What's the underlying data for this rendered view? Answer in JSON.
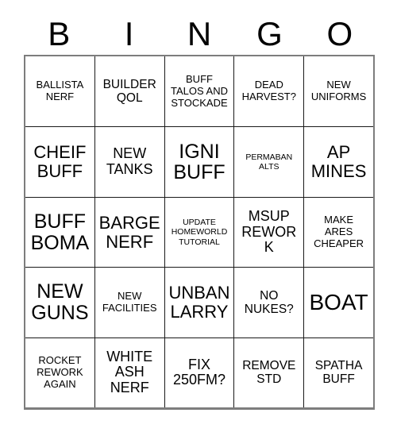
{
  "card": {
    "header_letters": [
      "B",
      "I",
      "N",
      "G",
      "O"
    ],
    "columns": 5,
    "rows": 5,
    "colors": {
      "background": "#ffffff",
      "text": "#000000",
      "inner_grid_line": "#1a1a1a",
      "outer_border": "#7d7d7d"
    },
    "cells": [
      {
        "text": "BALLISTA\nNERF",
        "size": "sm"
      },
      {
        "text": "BUILDER\nQOL",
        "size": "md"
      },
      {
        "text": "BUFF\nTALOS AND\nSTOCKADE",
        "size": "sm"
      },
      {
        "text": "DEAD\nHARVEST?",
        "size": "sm"
      },
      {
        "text": "NEW\nUNIFORMS",
        "size": "sm"
      },
      {
        "text": "CHEIF\nBUFF",
        "size": "xl"
      },
      {
        "text": "NEW\nTANKS",
        "size": "lg"
      },
      {
        "text": "IGNI\nBUFF",
        "size": "xxl"
      },
      {
        "text": "PERMABAN\nALTS",
        "size": "xs"
      },
      {
        "text": "AP\nMINES",
        "size": "xl"
      },
      {
        "text": "BUFF\nBOMA",
        "size": "xxl"
      },
      {
        "text": "BARGE\nNERF",
        "size": "xl"
      },
      {
        "text": "UPDATE\nHOMEWORLD\nTUTORIAL",
        "size": "xs"
      },
      {
        "text": "MSUP\nREWORK",
        "size": "lg"
      },
      {
        "text": "MAKE\nARES\nCHEAPER",
        "size": "sm"
      },
      {
        "text": "NEW\nGUNS",
        "size": "xxl"
      },
      {
        "text": "NEW\nFACILITIES",
        "size": "sm"
      },
      {
        "text": "UNBAN\nLARRY",
        "size": "xl"
      },
      {
        "text": "NO\nNUKES?",
        "size": "md"
      },
      {
        "text": "BOAT",
        "size": "huge"
      },
      {
        "text": "ROCKET\nREWORK\nAGAIN",
        "size": "sm"
      },
      {
        "text": "WHITE\nASH\nNERF",
        "size": "lg"
      },
      {
        "text": "FIX\n250FM?",
        "size": "lg"
      },
      {
        "text": "REMOVE\nSTD",
        "size": "md"
      },
      {
        "text": "SPATHA\nBUFF",
        "size": "md"
      }
    ]
  }
}
